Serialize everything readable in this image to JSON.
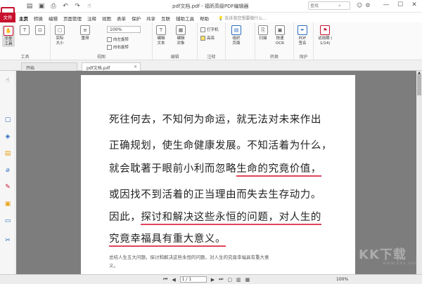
{
  "window": {
    "title": "pdf文档.pdf - 福昕高级PDF编辑器",
    "search_placeholder": "查找"
  },
  "menu": {
    "file": "文件",
    "items": [
      "主页",
      "转换",
      "编辑",
      "页面管理",
      "注释",
      "视图",
      "表单",
      "保护",
      "共享",
      "互联",
      "辅助工具",
      "帮助"
    ],
    "tell_me": "告诉我您想要做什么..."
  },
  "ribbon": {
    "groups": {
      "tools": "工具",
      "view": "视图",
      "edit": "编辑",
      "comment": "注释",
      "convert": "转换",
      "protect": "保护"
    },
    "buttons": {
      "hand": "手型\n工具",
      "actual_size": "实际\n大小",
      "reflow": "重排",
      "zoom": "100%",
      "rotate_left": "向左旋转",
      "rotate_right": "向右旋转",
      "edit_text": "编辑\n文本",
      "edit_object": "编辑\n对象",
      "typewriter": "打字机",
      "highlight": "高亮",
      "organize": "组织\n页面",
      "scan": "扫描",
      "ocr": "快速\nOCR",
      "pdf_sign": "PDF\n签名",
      "trial": "试用期 (\n1/14)"
    }
  },
  "tabs": {
    "start": "开始",
    "doc": "pdf文档.pdf"
  },
  "document": {
    "lines": [
      "死往何去，不知何为命运，就无法对未来作出",
      "正确规划，使生命健康发展。不知活着为什么，",
      "就会耽著于眼前小利而忽略",
      "或因找不到活着的正当理由而失去生存动力。",
      "因此，",
      "究竟幸福具有重大意义。"
    ],
    "underline_1": "生命的究竟价值，",
    "underline_2": "探讨和解决这些永恒的问题，对人生的",
    "underline_3_prefix": "究竟幸福具有重大意义。",
    "caption_1": "总结人生五大问题，探讨和解决这些永恒的问题，对人生的究竟幸福具有重大意",
    "caption_2": "义。"
  },
  "status": {
    "page": "1 / 1",
    "zoom": "100%"
  },
  "watermark": {
    "main": "KK下载",
    "sub": "www.kkx.net"
  }
}
